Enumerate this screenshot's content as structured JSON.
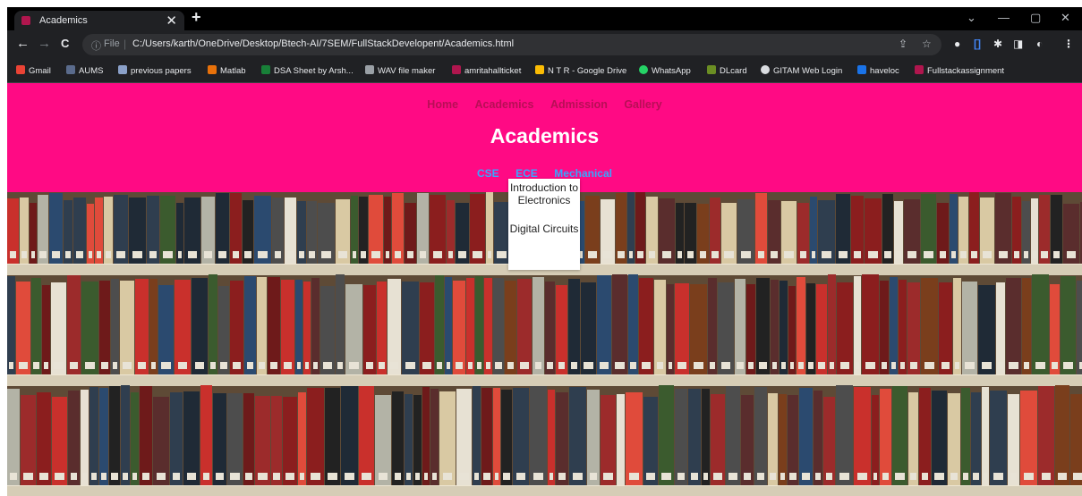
{
  "browser": {
    "tab_title": "Academics",
    "tab_close": "✕",
    "new_tab": "+",
    "window_controls": [
      "⌄",
      "—",
      "▢",
      "✕"
    ],
    "nav": {
      "back": "←",
      "forward": "→",
      "reload": "C"
    },
    "omnibox": {
      "info": "ⓘ",
      "scheme_label": "File",
      "separator": "|",
      "url": "C:/Users/karth/OneDrive/Desktop/Btech-AI/7SEM/FullStackDevelopent/Academics.html"
    },
    "omnibox_actions": [
      "⇪",
      "☆"
    ],
    "extensions": [
      "●",
      "[]",
      "✱",
      "◨",
      "◐",
      "⋮"
    ],
    "bookmarks": [
      {
        "label": "Gmail",
        "color": "#ea4335"
      },
      {
        "label": "AUMS",
        "color": "#5a6b8c"
      },
      {
        "label": "previous papers",
        "color": "#8aa0c8"
      },
      {
        "label": "Matlab",
        "color": "#e8710a"
      },
      {
        "label": "DSA Sheet by Arsh...",
        "color": "#188038"
      },
      {
        "label": "WAV file maker",
        "color": "#9aa0a6"
      },
      {
        "label": "amritahallticket",
        "color": "#b0164e"
      },
      {
        "label": "N T R - Google Drive",
        "color": "#fbbc04"
      },
      {
        "label": "WhatsApp",
        "color": "#25d366"
      },
      {
        "label": "DLcard",
        "color": "#6b8e23"
      },
      {
        "label": "GITAM Web Login",
        "color": "#dadce0"
      },
      {
        "label": "haveloc",
        "color": "#1a73e8"
      },
      {
        "label": "Fullstackassignment",
        "color": "#b0164e"
      }
    ]
  },
  "page": {
    "header_color": "#ff0a84",
    "nav": [
      "Home",
      "Academics",
      "Admission",
      "Gallery"
    ],
    "title": "Academics",
    "subnav": [
      "CSE",
      "ECE",
      "Mechanical"
    ],
    "dropdown": [
      "Introduction to Electronics",
      "Digital Circuits"
    ]
  }
}
